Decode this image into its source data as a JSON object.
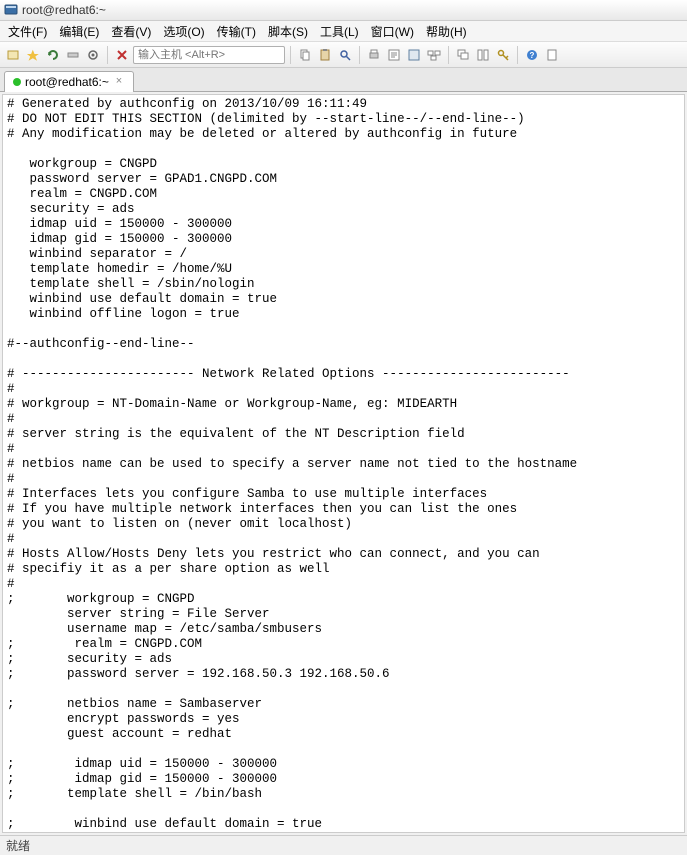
{
  "titlebar": {
    "text": "root@redhat6:~"
  },
  "menubar": {
    "items": [
      "文件(F)",
      "编辑(E)",
      "查看(V)",
      "选项(O)",
      "传输(T)",
      "脚本(S)",
      "工具(L)",
      "窗口(W)",
      "帮助(H)"
    ]
  },
  "toolbar": {
    "host_placeholder": "输入主机 <Alt+R>"
  },
  "tabs": {
    "items": [
      {
        "label": "root@redhat6:~",
        "close": "×"
      }
    ]
  },
  "terminal": {
    "content": "# Generated by authconfig on 2013/10/09 16:11:49\n# DO NOT EDIT THIS SECTION (delimited by --start-line--/--end-line--)\n# Any modification may be deleted or altered by authconfig in future\n\n   workgroup = CNGPD\n   password server = GPAD1.CNGPD.COM\n   realm = CNGPD.COM\n   security = ads\n   idmap uid = 150000 - 300000\n   idmap gid = 150000 - 300000\n   winbind separator = /\n   template homedir = /home/%U\n   template shell = /sbin/nologin\n   winbind use default domain = true\n   winbind offline logon = true\n\n#--authconfig--end-line--\n\n# ----------------------- Network Related Options -------------------------\n#\n# workgroup = NT-Domain-Name or Workgroup-Name, eg: MIDEARTH\n#\n# server string is the equivalent of the NT Description field\n#\n# netbios name can be used to specify a server name not tied to the hostname\n#\n# Interfaces lets you configure Samba to use multiple interfaces\n# If you have multiple network interfaces then you can list the ones\n# you want to listen on (never omit localhost)\n#\n# Hosts Allow/Hosts Deny lets you restrict who can connect, and you can\n# specifiy it as a per share option as well\n#\n;       workgroup = CNGPD\n        server string = File Server\n        username map = /etc/samba/smbusers\n;        realm = CNGPD.COM\n;       security = ads\n;       password server = 192.168.50.3 192.168.50.6\n\n;       netbios name = Sambaserver\n        encrypt passwords = yes\n        guest account = redhat\n\n;        idmap uid = 150000 - 300000\n;        idmap gid = 150000 - 300000\n;       template shell = /bin/bash\n\n;        winbind use default domain = true\n;        winbind offline logon = true\n;        template homedir = /home/%U\n;       winbind separator = /\n        winbind enum users = yes\n        winbind enum groups = yes\n        encrypt passwords = yes"
  },
  "statusbar": {
    "text": "就绪"
  }
}
